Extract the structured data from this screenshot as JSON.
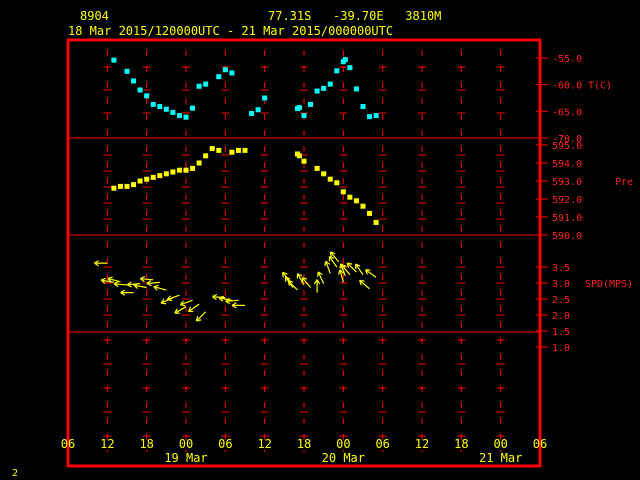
{
  "header": {
    "station": "8904",
    "location": "77.31S   -39.70E   3810M",
    "period": "18 Mar 2015/120000UTC - 21 Mar 2015/000000UTC",
    "page_number": "2"
  },
  "colors": {
    "frame": "#ff0000",
    "temp": "#00ffff",
    "pressure": "#ffff00",
    "wind": "#ffff00",
    "axis_text": "#ff2020",
    "time_text": "#ffff00"
  },
  "chart_data": {
    "type": "scatter",
    "x_unit": "hours since 18 Mar 2015 06 UTC",
    "xlim": [
      0,
      66
    ],
    "x_ticks": [
      0,
      6,
      12,
      18,
      24,
      30,
      36,
      42,
      48,
      54,
      60,
      66
    ],
    "x_tick_labels": [
      "06",
      "12",
      "18",
      "00",
      "06",
      "12",
      "18",
      "00",
      "06",
      "12",
      "18",
      "00",
      "06"
    ],
    "x_tick_labels_hours": [
      0,
      6,
      12,
      18,
      24,
      30,
      36,
      42,
      48,
      54,
      60,
      66,
      72
    ],
    "date_labels": [
      {
        "label": "19 Mar",
        "hour": 18
      },
      {
        "label": "20 Mar",
        "hour": 42
      },
      {
        "label": "21 Mar",
        "hour": 66
      }
    ],
    "panels": [
      {
        "name": "T(C)",
        "ticks": [
          -55.0,
          -60.0,
          -65.0,
          -70.0
        ],
        "tick_labels": [
          "-55.0",
          "-60.0",
          "-65.0",
          "-70.0"
        ],
        "ylim": [
          -70,
          -54
        ],
        "marker": "square",
        "points": [
          [
            7,
            -55.4
          ],
          [
            9,
            -57.5
          ],
          [
            10,
            -59.3
          ],
          [
            11,
            -61
          ],
          [
            12,
            -62.1
          ],
          [
            13,
            -63.7
          ],
          [
            14,
            -64.1
          ],
          [
            15,
            -64.6
          ],
          [
            16,
            -65.2
          ],
          [
            17,
            -65.8
          ],
          [
            18,
            -66.1
          ],
          [
            19,
            -64.4
          ],
          [
            20,
            -60.3
          ],
          [
            21,
            -59.9
          ],
          [
            23,
            -58.5
          ],
          [
            24,
            -57.2
          ],
          [
            25,
            -57.8
          ],
          [
            28,
            -65.4
          ],
          [
            29,
            -64.7
          ],
          [
            30,
            -62.5
          ],
          [
            35,
            -64.5
          ],
          [
            35.3,
            -64.3
          ],
          [
            36,
            -65.8
          ],
          [
            37,
            -63.7
          ],
          [
            38,
            -61.2
          ],
          [
            39,
            -60.7
          ],
          [
            40,
            -59.9
          ],
          [
            41,
            -57.4
          ],
          [
            42,
            -55.7
          ],
          [
            42.3,
            -55.3
          ],
          [
            43,
            -56.8
          ],
          [
            44,
            -60.8
          ],
          [
            45,
            -64.1
          ],
          [
            46,
            -66
          ],
          [
            47,
            -65.8
          ]
        ]
      },
      {
        "name": "Pre (mb)",
        "ticks": [
          595.0,
          594.0,
          593.0,
          592.0,
          591.0,
          590.0
        ],
        "tick_labels": [
          "595.0",
          "594.0",
          "593.0",
          "592.0",
          "591.0",
          "590.0"
        ],
        "ylim": [
          590,
          596
        ],
        "marker": "square",
        "points": [
          [
            7,
            592.6
          ],
          [
            8,
            592.7
          ],
          [
            9,
            592.7
          ],
          [
            10,
            592.8
          ],
          [
            11,
            593.0
          ],
          [
            12,
            593.1
          ],
          [
            13,
            593.2
          ],
          [
            14,
            593.3
          ],
          [
            15,
            593.4
          ],
          [
            16,
            593.5
          ],
          [
            17,
            593.6
          ],
          [
            18,
            593.6
          ],
          [
            19,
            593.7
          ],
          [
            20,
            594.0
          ],
          [
            21,
            594.4
          ],
          [
            22,
            594.8
          ],
          [
            23,
            594.7
          ],
          [
            25,
            594.6
          ],
          [
            26,
            594.7
          ],
          [
            27,
            594.7
          ],
          [
            35,
            594.5
          ],
          [
            35.3,
            594.4
          ],
          [
            36,
            594.1
          ],
          [
            38,
            593.7
          ],
          [
            39,
            593.4
          ],
          [
            40,
            593.1
          ],
          [
            41,
            592.9
          ],
          [
            42,
            592.4
          ],
          [
            43,
            592.1
          ],
          [
            44,
            591.9
          ],
          [
            45,
            591.6
          ],
          [
            46,
            591.2
          ],
          [
            47,
            590.7
          ]
        ]
      },
      {
        "name": "SPD(MPS)",
        "ticks": [
          3.5,
          3.0,
          2.5,
          2.0,
          1.5,
          1.0
        ],
        "tick_labels": [
          "3.5",
          "3.0",
          "2.5",
          "2.0",
          "1.5",
          "1.0"
        ],
        "ylim": [
          1.0,
          3.9
        ],
        "marker": "wind-arrow",
        "points": [
          [
            6,
            3.65,
            180
          ],
          [
            7,
            2.9,
            170
          ],
          [
            8,
            2.92,
            165
          ],
          [
            9,
            2.8,
            175
          ],
          [
            10,
            2.5,
            180
          ],
          [
            11,
            2.85,
            185
          ],
          [
            12,
            2.7,
            170
          ],
          [
            13,
            3.0,
            175
          ],
          [
            14,
            2.9,
            185
          ],
          [
            15,
            2.6,
            165
          ],
          [
            16,
            2.3,
            205
          ],
          [
            17,
            2.4,
            200
          ],
          [
            18,
            1.95,
            210
          ],
          [
            19,
            2.2,
            200
          ],
          [
            20,
            2.05,
            215
          ],
          [
            21,
            1.75,
            225
          ],
          [
            24,
            2.3,
            175
          ],
          [
            25,
            2.2,
            170
          ],
          [
            26,
            2.2,
            185
          ],
          [
            27,
            2.0,
            180
          ],
          [
            34,
            2.9,
            130
          ],
          [
            34.3,
            2.7,
            125
          ],
          [
            35,
            2.6,
            135
          ],
          [
            36,
            2.8,
            120
          ],
          [
            37,
            2.7,
            130
          ],
          [
            38,
            2.5,
            90
          ],
          [
            39,
            2.85,
            115
          ],
          [
            40,
            3.25,
            110
          ],
          [
            41,
            3.5,
            125
          ],
          [
            41.3,
            3.7,
            130
          ],
          [
            42,
            2.9,
            105
          ],
          [
            42.3,
            3.15,
            110
          ],
          [
            43,
            3.2,
            130
          ],
          [
            44,
            3.3,
            135
          ],
          [
            45,
            3.2,
            125
          ],
          [
            46,
            2.65,
            140
          ],
          [
            47,
            3.1,
            145
          ]
        ]
      }
    ]
  }
}
